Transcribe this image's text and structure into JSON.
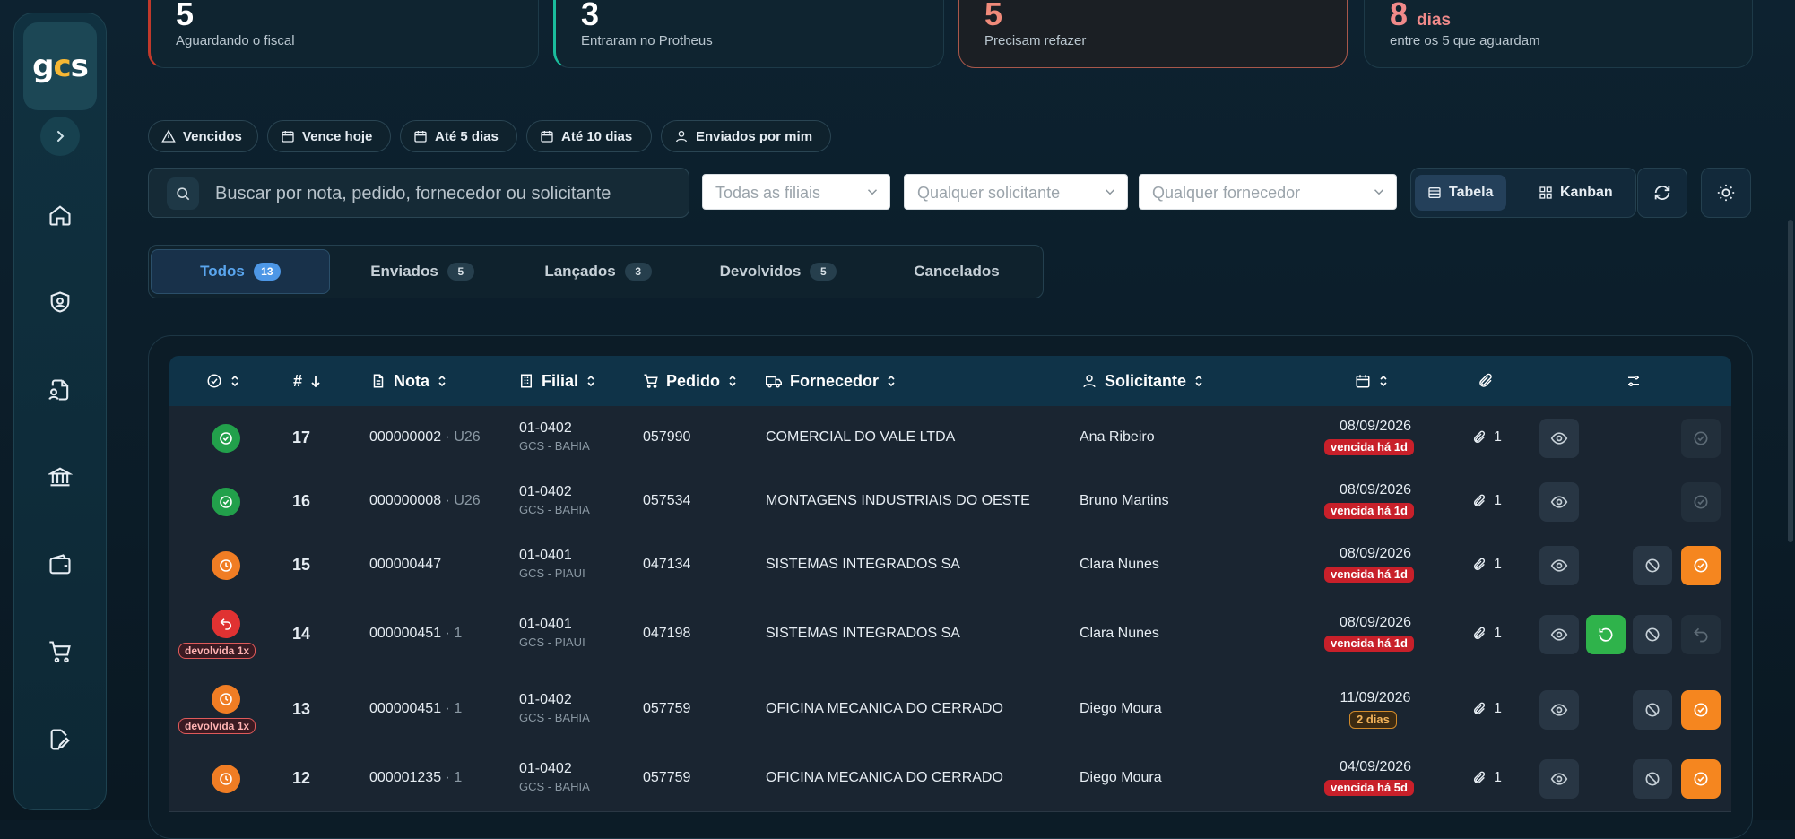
{
  "brand": {
    "logo_text": "gcs"
  },
  "stats": [
    {
      "value": "5",
      "suffix": "",
      "label": "Aguardando o fiscal",
      "accent": "#c0392b"
    },
    {
      "value": "3",
      "suffix": "",
      "label": "Entraram no Protheus",
      "accent": "#1abc9c"
    },
    {
      "value": "5",
      "suffix": "",
      "label": "Precisam refazer",
      "accent": "#e07a5f"
    },
    {
      "value": "8",
      "suffix": "dias",
      "label": "entre os 5 que aguardam",
      "accent": "#f08080"
    }
  ],
  "chips": [
    "Vencidos",
    "Vence hoje",
    "Até 5 dias",
    "Até 10 dias",
    "Enviados por mim"
  ],
  "search": {
    "placeholder": "Buscar por nota, pedido, fornecedor ou solicitante"
  },
  "filters": {
    "filial": "Todas as filiais",
    "solicitante": "Qualquer solicitante",
    "fornecedor": "Qualquer fornecedor"
  },
  "view_toggle": {
    "table": "Tabela",
    "kanban": "Kanban",
    "active": "table"
  },
  "tabs": [
    {
      "label": "Todos",
      "count": "13",
      "active": true
    },
    {
      "label": "Enviados",
      "count": "5",
      "active": false
    },
    {
      "label": "Lançados",
      "count": "3",
      "active": false
    },
    {
      "label": "Devolvidos",
      "count": "5",
      "active": false
    },
    {
      "label": "Cancelados",
      "count": "",
      "active": false
    }
  ],
  "columns": {
    "status": "",
    "id": "#",
    "nota": "Nota",
    "filial": "Filial",
    "pedido": "Pedido",
    "fornecedor": "Fornecedor",
    "solicitante": "Solicitante"
  },
  "rows": [
    {
      "status": "ok",
      "id": "17",
      "nota": "000000002",
      "serie": "U26",
      "filial": "01-0402",
      "filial_nome": "GCS - BAHIA",
      "pedido": "057990",
      "fornecedor": "COMERCIAL DO VALE LTDA",
      "solicitante": "Ana Ribeiro",
      "data": "08/09/2026",
      "prazo": "vencida há 1d",
      "prazo_tipo": "overdue",
      "anexos": "1",
      "devolvida": ""
    },
    {
      "status": "ok",
      "id": "16",
      "nota": "000000008",
      "serie": "U26",
      "filial": "01-0402",
      "filial_nome": "GCS - BAHIA",
      "pedido": "057534",
      "fornecedor": "MONTAGENS INDUSTRIAIS DO OESTE",
      "solicitante": "Bruno Martins",
      "data": "08/09/2026",
      "prazo": "vencida há 1d",
      "prazo_tipo": "overdue",
      "anexos": "1",
      "devolvida": ""
    },
    {
      "status": "pending",
      "id": "15",
      "nota": "000000447",
      "serie": "",
      "filial": "01-0401",
      "filial_nome": "GCS - PIAUI",
      "pedido": "047134",
      "fornecedor": "SISTEMAS INTEGRADOS SA",
      "solicitante": "Clara Nunes",
      "data": "08/09/2026",
      "prazo": "vencida há 1d",
      "prazo_tipo": "overdue",
      "anexos": "1",
      "devolvida": ""
    },
    {
      "status": "returned",
      "id": "14",
      "nota": "000000451",
      "serie": "1",
      "filial": "01-0401",
      "filial_nome": "GCS - PIAUI",
      "pedido": "047198",
      "fornecedor": "SISTEMAS INTEGRADOS SA",
      "solicitante": "Clara Nunes",
      "data": "08/09/2026",
      "prazo": "vencida há 1d",
      "prazo_tipo": "overdue",
      "anexos": "1",
      "devolvida": "devolvida 1x"
    },
    {
      "status": "pending",
      "id": "13",
      "nota": "000000451",
      "serie": "1",
      "filial": "01-0402",
      "filial_nome": "GCS - BAHIA",
      "pedido": "057759",
      "fornecedor": "OFICINA MECANICA DO CERRADO",
      "solicitante": "Diego Moura",
      "data": "11/09/2026",
      "prazo": "2 dias",
      "prazo_tipo": "soon",
      "anexos": "1",
      "devolvida": "devolvida 1x"
    },
    {
      "status": "pending",
      "id": "12",
      "nota": "000001235",
      "serie": "1",
      "filial": "01-0402",
      "filial_nome": "GCS - BAHIA",
      "pedido": "057759",
      "fornecedor": "OFICINA MECANICA DO CERRADO",
      "solicitante": "Diego Moura",
      "data": "04/09/2026",
      "prazo": "vencida há 5d",
      "prazo_tipo": "overdue",
      "anexos": "1",
      "devolvida": ""
    }
  ]
}
